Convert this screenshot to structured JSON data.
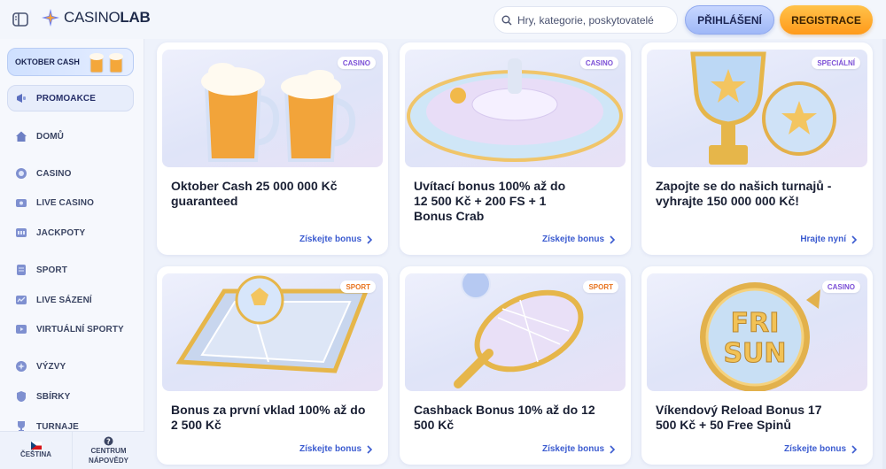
{
  "header": {
    "logo_primary": "CASINO",
    "logo_secondary": "LAB",
    "search_placeholder": "Hry, kategorie, poskytovatelé",
    "login_label": "PŘIHLÁŠENÍ",
    "register_label": "REGISTRACE"
  },
  "sidebar": {
    "promo_tile": "OKTOBER CASH",
    "items": [
      {
        "label": "PROMOAKCE",
        "icon": "megaphone-icon"
      },
      {
        "label": "DOMŮ",
        "icon": "home-icon"
      },
      {
        "label": "CASINO",
        "icon": "chip-icon"
      },
      {
        "label": "LIVE CASINO",
        "icon": "live-icon"
      },
      {
        "label": "JACKPOTY",
        "icon": "jackpot-icon"
      },
      {
        "label": "SPORT",
        "icon": "sport-icon"
      },
      {
        "label": "LIVE SÁZENÍ",
        "icon": "live-bet-icon"
      },
      {
        "label": "VIRTUÁLNÍ SPORTY",
        "icon": "virtual-icon"
      },
      {
        "label": "VÝZVY",
        "icon": "challenge-icon"
      },
      {
        "label": "SBÍRKY",
        "icon": "collection-icon"
      },
      {
        "label": "TURNAJE",
        "icon": "trophy-icon"
      }
    ],
    "footer": {
      "language": "ČEŠTINA",
      "help_line1": "CENTRUM",
      "help_line2": "NÁPOVĚDY"
    }
  },
  "cards": [
    {
      "badge": "CASINO",
      "title": "Oktober Cash 25 000 000 Kč guaranteed",
      "link": "Získejte bonus"
    },
    {
      "badge": "CASINO",
      "title": "Uvítací bonus 100% až do 12 500 Kč + 200 FS + 1 Bonus Crab",
      "link": "Získejte bonus"
    },
    {
      "badge": "SPECIÁLNÍ",
      "title": "Zapojte se do našich turnajů - vyhrajte 150 000 000 Kč!",
      "link": "Hrajte nyní"
    },
    {
      "badge": "SPORT",
      "title": "Bonus za první vklad 100% až do 2 500 Kč",
      "link": "Získejte bonus"
    },
    {
      "badge": "SPORT",
      "title": "Cashback Bonus 10% až do 12 500 Kč",
      "link": "Získejte bonus"
    },
    {
      "badge": "CASINO",
      "title": "Víkendový Reload Bonus 17 500 Kč + 50 Free Spinů",
      "link": "Získejte bonus",
      "art_text_1": "FRI",
      "art_text_2": "SUN"
    }
  ],
  "colors": {
    "accent_blue": "#3b5bd0",
    "register_orange": "#ff9a1a",
    "badge_casino": "#7b4fd6",
    "badge_sport": "#e8731e"
  }
}
